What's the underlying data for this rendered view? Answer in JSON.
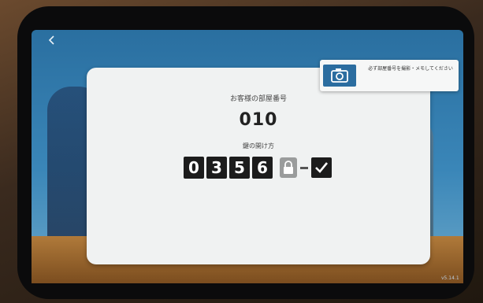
{
  "app": {
    "back_icon": "chevron-left-icon",
    "camera_icon": "camera-icon",
    "banner_text": "必ず部屋番号を撮影・メモしてください",
    "room_label": "お客様の部屋番号",
    "room_number": "010",
    "unlock_label": "鍵の開け方",
    "code_digits": [
      "0",
      "3",
      "5",
      "6"
    ],
    "lock_icon": "lock-icon",
    "check_icon": "check-icon",
    "version": "v5.14.1"
  },
  "colors": {
    "screen_blue": "#2b6da0",
    "card": "#f0f2f2",
    "digit_bg": "#1c1c1c"
  }
}
